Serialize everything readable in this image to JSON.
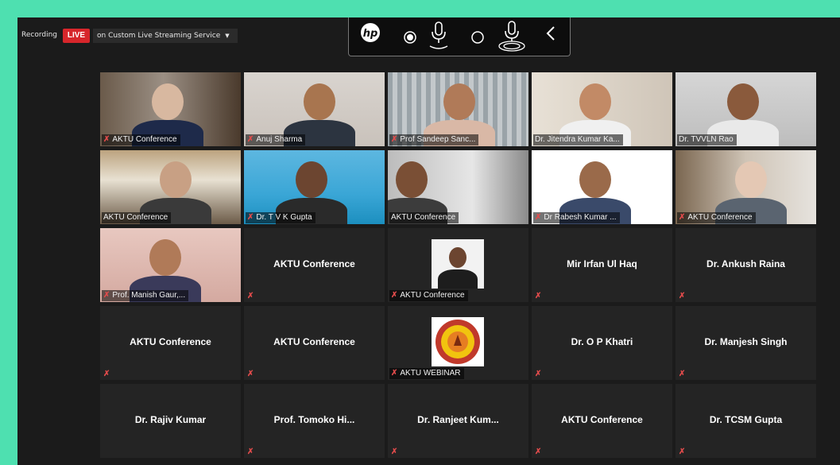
{
  "recording": {
    "label": "Recording",
    "live_badge": "LIVE",
    "stream_service": "on Custom Live Streaming Service"
  },
  "toolbar": {
    "icons": [
      "hp-logo-icon",
      "record-dot-icon",
      "microphone-icon",
      "circle-icon",
      "microphone-active-icon",
      "chevron-left-icon"
    ]
  },
  "participants": [
    {
      "name": "AKTU Conference",
      "video": true,
      "muted": true
    },
    {
      "name": "Anuj Sharma",
      "video": true,
      "muted": true
    },
    {
      "name": "Prof Sandeep Sanc...",
      "video": true,
      "muted": true
    },
    {
      "name": "Dr. Jitendra Kumar Ka...",
      "video": true,
      "muted": false
    },
    {
      "name": "Dr. TVVLN Rao",
      "video": true,
      "muted": false
    },
    {
      "name": "AKTU Conference",
      "video": true,
      "muted": false,
      "active": true
    },
    {
      "name": "Dr. T V K Gupta",
      "video": true,
      "muted": true
    },
    {
      "name": "AKTU Conference",
      "video": true,
      "muted": false
    },
    {
      "name": "Dr Rabesh Kumar ...",
      "video": true,
      "muted": true
    },
    {
      "name": "AKTU Conference",
      "video": true,
      "muted": true
    },
    {
      "name": "Prof. Manish Gaur,...",
      "video": true,
      "muted": true
    },
    {
      "name": "AKTU Conference",
      "video": false,
      "muted": true
    },
    {
      "name": "AKTU Conference",
      "video": true,
      "muted": true
    },
    {
      "name": "Mir Irfan Ul Haq",
      "video": false,
      "muted": true
    },
    {
      "name": "Dr. Ankush Raina",
      "video": false,
      "muted": true
    },
    {
      "name": "AKTU Conference",
      "video": false,
      "muted": true
    },
    {
      "name": "AKTU Conference",
      "video": false,
      "muted": true
    },
    {
      "name": "AKTU WEBINAR",
      "video": true,
      "muted": true
    },
    {
      "name": "Dr. O P Khatri",
      "video": false,
      "muted": true
    },
    {
      "name": "Dr. Manjesh Singh",
      "video": false,
      "muted": true
    },
    {
      "name": "Dr. Rajiv Kumar",
      "video": false,
      "muted": false
    },
    {
      "name": "Prof. Tomoko Hi...",
      "video": false,
      "muted": true
    },
    {
      "name": "Dr. Ranjeet Kum...",
      "video": false,
      "muted": true
    },
    {
      "name": "AKTU Conference",
      "video": false,
      "muted": true
    },
    {
      "name": "Dr. TCSM Gupta",
      "video": false,
      "muted": true
    }
  ],
  "colors": {
    "live": "#d7262b",
    "active_speaker": "#e0db4c",
    "muted_mic": "#e14b4b",
    "frame": "#4ee0b0"
  }
}
